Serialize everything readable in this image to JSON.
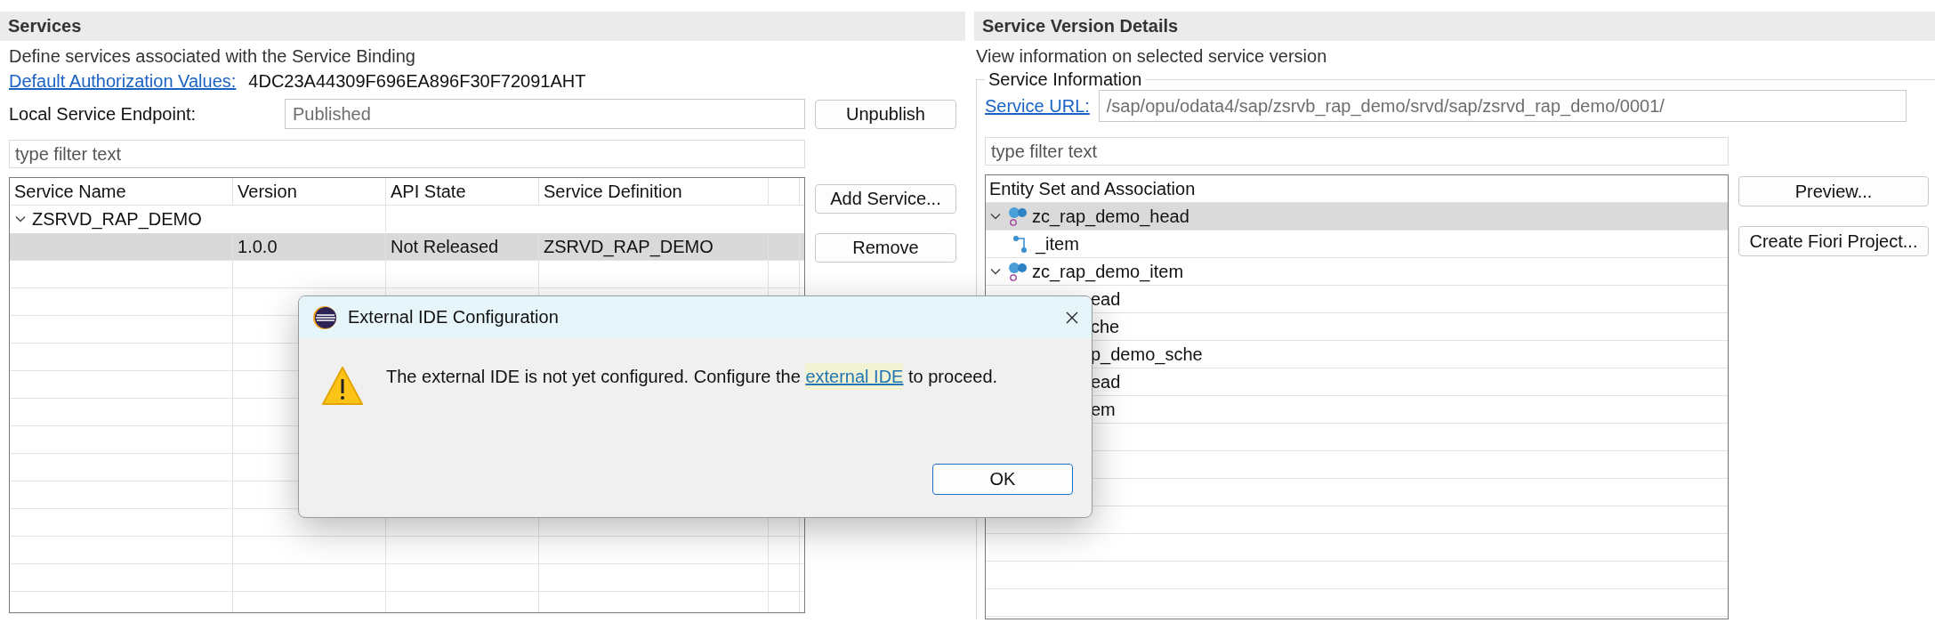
{
  "services": {
    "title": "Services",
    "description": "Define services associated with the Service Binding",
    "authorization": {
      "link": "Default Authorization Values:",
      "value": "4DC23A44309F696EA896F30F72091AHT"
    },
    "endpoint": {
      "label": "Local Service Endpoint:",
      "value": "Published",
      "read_only": true
    },
    "unpublish_button": "Unpublish",
    "filter": {
      "placeholder": "type filter text"
    },
    "table": {
      "columns": [
        "Service Name",
        "Version",
        "API State",
        "Service Definition"
      ],
      "rows": [
        {
          "kind": "service",
          "name": "ZSRVD_RAP_DEMO",
          "expanded": true,
          "selected": false
        },
        {
          "kind": "version",
          "version": "1.0.0",
          "api_state": "Not Released",
          "service_definition": "ZSRVD_RAP_DEMO",
          "selected": true
        }
      ]
    },
    "buttons": [
      "Add Service...",
      "Remove"
    ]
  },
  "details": {
    "title": "Service Version Details",
    "description": "View information on selected service version",
    "group_title": "Service Information",
    "service_url": {
      "link": "Service URL:",
      "value": "/sap/opu/odata4/sap/zsrvb_rap_demo/srvd/sap/zsrvd_rap_demo/0001/",
      "read_only": true
    },
    "filter": {
      "placeholder": "type filter text"
    },
    "tree": {
      "column": "Entity Set and Association",
      "items": [
        {
          "label": "zc_rap_demo_head",
          "kind": "entity",
          "expanded": true,
          "selected": true,
          "children": [
            {
              "label": "_item",
              "kind": "association",
              "selected": false
            }
          ]
        },
        {
          "label": "zc_rap_demo_item",
          "kind": "entity",
          "expanded": true,
          "selected": false,
          "children": [
            {
              "label": "ead",
              "cut": true,
              "selected": false
            },
            {
              "label": "che",
              "cut": true,
              "selected": false
            }
          ]
        },
        {
          "label": "p_demo_sche",
          "cut": true,
          "selected": false,
          "children": [
            {
              "label": "ead",
              "cut": true,
              "selected": false
            },
            {
              "label": "em",
              "cut": true,
              "selected": false
            }
          ]
        }
      ]
    },
    "buttons": [
      "Preview...",
      "Create Fiori Project..."
    ]
  },
  "dialog": {
    "title": "External IDE Configuration",
    "message": {
      "before": "The external IDE is not yet configured. Configure the ",
      "link": "external IDE",
      "after": " to proceed."
    },
    "buttons": [
      "OK"
    ]
  }
}
